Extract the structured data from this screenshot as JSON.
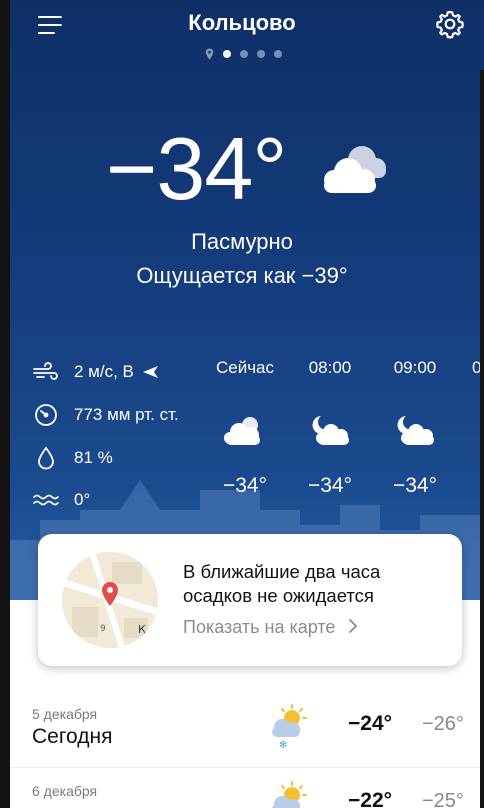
{
  "header": {
    "city": "Кольцово"
  },
  "pager": {
    "count": 4,
    "active": 1
  },
  "current": {
    "temperature": "−34°",
    "condition": "Пасмурно",
    "feels_like": "Ощущается как −39°",
    "icon": "cloudy-icon"
  },
  "stats": {
    "wind": "2 м/с, В",
    "pressure": "773 мм рт. ст.",
    "humidity": "81 %",
    "water": "0°"
  },
  "hourly": [
    {
      "time": "Сейчас",
      "temp": "−34°",
      "icon": "cloud-sun-icon"
    },
    {
      "time": "08:00",
      "temp": "−34°",
      "icon": "cloud-moon-icon"
    },
    {
      "time": "09:00",
      "temp": "−34°",
      "icon": "cloud-moon-icon"
    },
    {
      "time": "0",
      "temp": "",
      "icon": "partial-icon"
    }
  ],
  "precip_card": {
    "line1": "В ближайшие два часа",
    "line2": "осадков не ожидается",
    "link": "Показать на карте",
    "map_label_9": "9",
    "map_label_k": "К"
  },
  "days": [
    {
      "date": "5 декабря",
      "name": "Сегодня",
      "hi": "−24°",
      "lo": "−26°",
      "icon": "snow-sun-cloud-icon"
    },
    {
      "date": "6 декабря",
      "name": "",
      "hi": "−22°",
      "lo": "−25°",
      "icon": "sun-cloud-icon"
    }
  ],
  "colors": {
    "bg_top": "#0e2f66",
    "bg_bottom": "#22579c",
    "text": "#ffffff",
    "muted": "#8c8c8c"
  }
}
